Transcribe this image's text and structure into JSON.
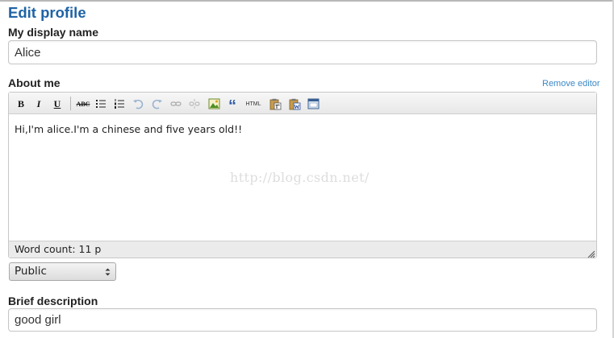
{
  "page": {
    "title": "Edit profile"
  },
  "display_name": {
    "label": "My display name",
    "value": "Alice"
  },
  "about": {
    "label": "About me",
    "remove_editor_link": "Remove editor",
    "content": "Hi,I'm alice.I'm a chinese and five years old!!",
    "word_count": "Word count: 11 p",
    "toolbar": {
      "bold": "B",
      "italic": "I",
      "underline": "U",
      "spellcheck": "ABC",
      "quote": "“",
      "html": "HTML",
      "icons": [
        "bold-icon",
        "italic-icon",
        "underline-icon",
        "spellcheck-icon",
        "bullet-list-icon",
        "numbered-list-icon",
        "undo-icon",
        "redo-icon",
        "link-icon",
        "unlink-icon",
        "image-icon",
        "blockquote-icon",
        "html-source-icon",
        "paste-text-icon",
        "paste-word-icon",
        "fullscreen-icon"
      ]
    }
  },
  "watermark": "http://blog.csdn.net/",
  "visibility": {
    "selected": "Public"
  },
  "brief": {
    "label": "Brief description",
    "value": "good girl"
  }
}
